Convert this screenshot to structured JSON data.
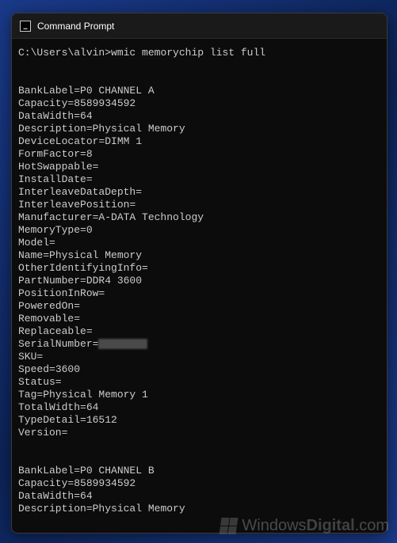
{
  "window": {
    "title": "Command Prompt"
  },
  "prompt": {
    "path": "C:\\Users\\alvin>",
    "command": "wmic memorychip list full"
  },
  "output": {
    "chip1": {
      "BankLabel": "P0 CHANNEL A",
      "Capacity": "8589934592",
      "DataWidth": "64",
      "Description": "Physical Memory",
      "DeviceLocator": "DIMM 1",
      "FormFactor": "8",
      "HotSwappable": "",
      "InstallDate": "",
      "InterleaveDataDepth": "",
      "InterleavePosition": "",
      "Manufacturer": "A-DATA Technology",
      "MemoryType": "0",
      "Model": "",
      "Name": "Physical Memory",
      "OtherIdentifyingInfo": "",
      "PartNumber": "DDR4 3600",
      "PositionInRow": "",
      "PoweredOn": "",
      "Removable": "",
      "Replaceable": "",
      "SerialNumber": "",
      "SKU": "",
      "Speed": "3600",
      "Status": "",
      "Tag": "Physical Memory 1",
      "TotalWidth": "64",
      "TypeDetail": "16512",
      "Version": ""
    },
    "chip2": {
      "BankLabel": "P0 CHANNEL B",
      "Capacity": "8589934592",
      "DataWidth": "64",
      "Description": "Physical Memory"
    }
  },
  "labels": {
    "BankLabel": "BankLabel=",
    "Capacity": "Capacity=",
    "DataWidth": "DataWidth=",
    "Description": "Description=",
    "DeviceLocator": "DeviceLocator=",
    "FormFactor": "FormFactor=",
    "HotSwappable": "HotSwappable=",
    "InstallDate": "InstallDate=",
    "InterleaveDataDepth": "InterleaveDataDepth=",
    "InterleavePosition": "InterleavePosition=",
    "Manufacturer": "Manufacturer=",
    "MemoryType": "MemoryType=",
    "Model": "Model=",
    "Name": "Name=",
    "OtherIdentifyingInfo": "OtherIdentifyingInfo=",
    "PartNumber": "PartNumber=",
    "PositionInRow": "PositionInRow=",
    "PoweredOn": "PoweredOn=",
    "Removable": "Removable=",
    "Replaceable": "Replaceable=",
    "SerialNumber": "SerialNumber=",
    "SKU": "SKU=",
    "Speed": "Speed=",
    "Status": "Status=",
    "Tag": "Tag=",
    "TotalWidth": "TotalWidth=",
    "TypeDetail": "TypeDetail=",
    "Version": "Version="
  },
  "watermark": {
    "text1": "Windows",
    "text2": "Digital",
    "text3": ".com"
  }
}
